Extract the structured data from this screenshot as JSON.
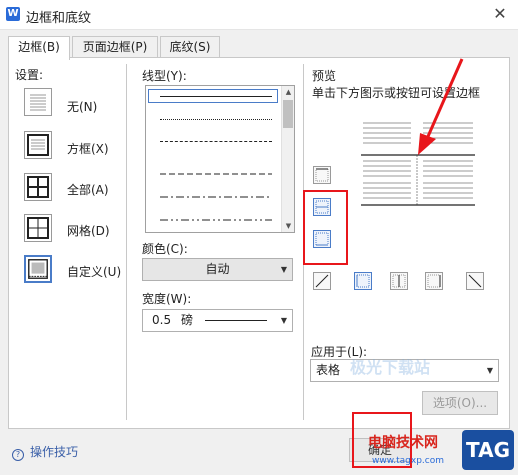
{
  "window": {
    "title": "边框和底纹",
    "app_logo": "W",
    "close_label": "✕"
  },
  "tabs": [
    {
      "label": "边框(B)",
      "active": true
    },
    {
      "label": "页面边框(P)",
      "active": false
    },
    {
      "label": "底纹(S)",
      "active": false
    }
  ],
  "settings": {
    "heading": "设置:",
    "items": [
      {
        "label": "无(N)",
        "icon": "none-border-icon"
      },
      {
        "label": "方框(X)",
        "icon": "box-border-icon"
      },
      {
        "label": "全部(A)",
        "icon": "all-border-icon"
      },
      {
        "label": "网格(D)",
        "icon": "grid-border-icon"
      },
      {
        "label": "自定义(U)",
        "icon": "custom-border-icon",
        "selected": true
      }
    ]
  },
  "line_style": {
    "heading": "线型(Y):",
    "styles": [
      "solid",
      "dotted",
      "dashed",
      "dash-dot",
      "dash-dot-dot",
      "long-dash"
    ]
  },
  "color": {
    "heading": "颜色(C):",
    "value": "自动"
  },
  "width": {
    "heading": "宽度(W):",
    "value": "0.5",
    "unit": "磅"
  },
  "preview": {
    "heading": "预览",
    "hint": "单击下方图示或按钮可设置边框"
  },
  "apply_to": {
    "heading": "应用于(L):",
    "value": "表格"
  },
  "buttons": {
    "options": "选项(O)...",
    "ok": "确定"
  },
  "tips": {
    "label": "操作技巧"
  },
  "watermark": {
    "text": "电脑技术网",
    "url": "www.tagxp.com",
    "tag": "TAG",
    "faint": "极光下载站"
  },
  "colors": {
    "accent": "#4a7cc8",
    "highlight_red": "#e8161b",
    "arrow_red": "#e8161b"
  }
}
